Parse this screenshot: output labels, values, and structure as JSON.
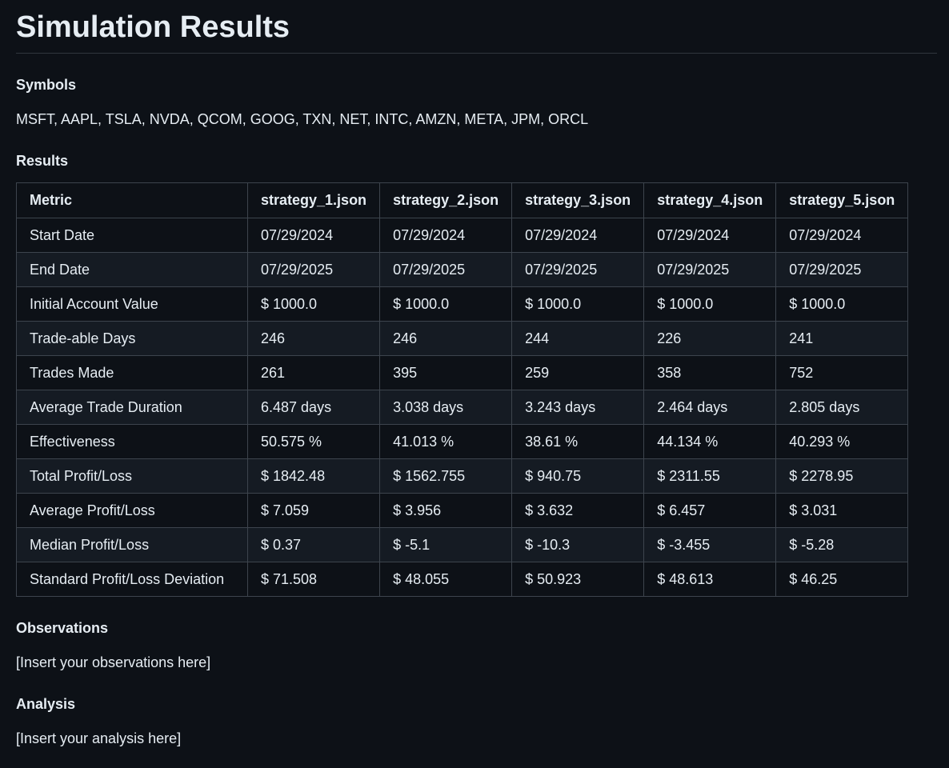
{
  "page": {
    "title": "Simulation Results"
  },
  "symbols": {
    "heading": "Symbols",
    "text": "MSFT, AAPL, TSLA, NVDA, QCOM, GOOG, TXN, NET, INTC, AMZN, META, JPM, ORCL"
  },
  "results": {
    "heading": "Results",
    "columns": [
      "Metric",
      "strategy_1.json",
      "strategy_2.json",
      "strategy_3.json",
      "strategy_4.json",
      "strategy_5.json"
    ],
    "rows": [
      [
        "Start Date",
        "07/29/2024",
        "07/29/2024",
        "07/29/2024",
        "07/29/2024",
        "07/29/2024"
      ],
      [
        "End Date",
        "07/29/2025",
        "07/29/2025",
        "07/29/2025",
        "07/29/2025",
        "07/29/2025"
      ],
      [
        "Initial Account Value",
        "$ 1000.0",
        "$ 1000.0",
        "$ 1000.0",
        "$ 1000.0",
        "$ 1000.0"
      ],
      [
        "Trade-able Days",
        "246",
        "246",
        "244",
        "226",
        "241"
      ],
      [
        "Trades Made",
        "261",
        "395",
        "259",
        "358",
        "752"
      ],
      [
        "Average Trade Duration",
        "6.487 days",
        "3.038 days",
        "3.243 days",
        "2.464 days",
        "2.805 days"
      ],
      [
        "Effectiveness",
        "50.575 %",
        "41.013 %",
        "38.61 %",
        "44.134 %",
        "40.293 %"
      ],
      [
        "Total Profit/Loss",
        "$ 1842.48",
        "$ 1562.755",
        "$ 940.75",
        "$ 2311.55",
        "$ 2278.95"
      ],
      [
        "Average Profit/Loss",
        "$ 7.059",
        "$ 3.956",
        "$ 3.632",
        "$ 6.457",
        "$ 3.031"
      ],
      [
        "Median Profit/Loss",
        "$ 0.37",
        "$ -5.1",
        "$ -10.3",
        "$ -3.455",
        "$ -5.28"
      ],
      [
        "Standard Profit/Loss Deviation",
        "$ 71.508",
        "$ 48.055",
        "$ 50.923",
        "$ 48.613",
        "$ 46.25"
      ]
    ]
  },
  "observations": {
    "heading": "Observations",
    "text": "[Insert your observations here]"
  },
  "analysis": {
    "heading": "Analysis",
    "text": "[Insert your analysis here]"
  },
  "colors": {
    "background": "#0d1117",
    "text": "#e6edf3",
    "border": "#3d444d",
    "row_alt": "#151b23"
  }
}
